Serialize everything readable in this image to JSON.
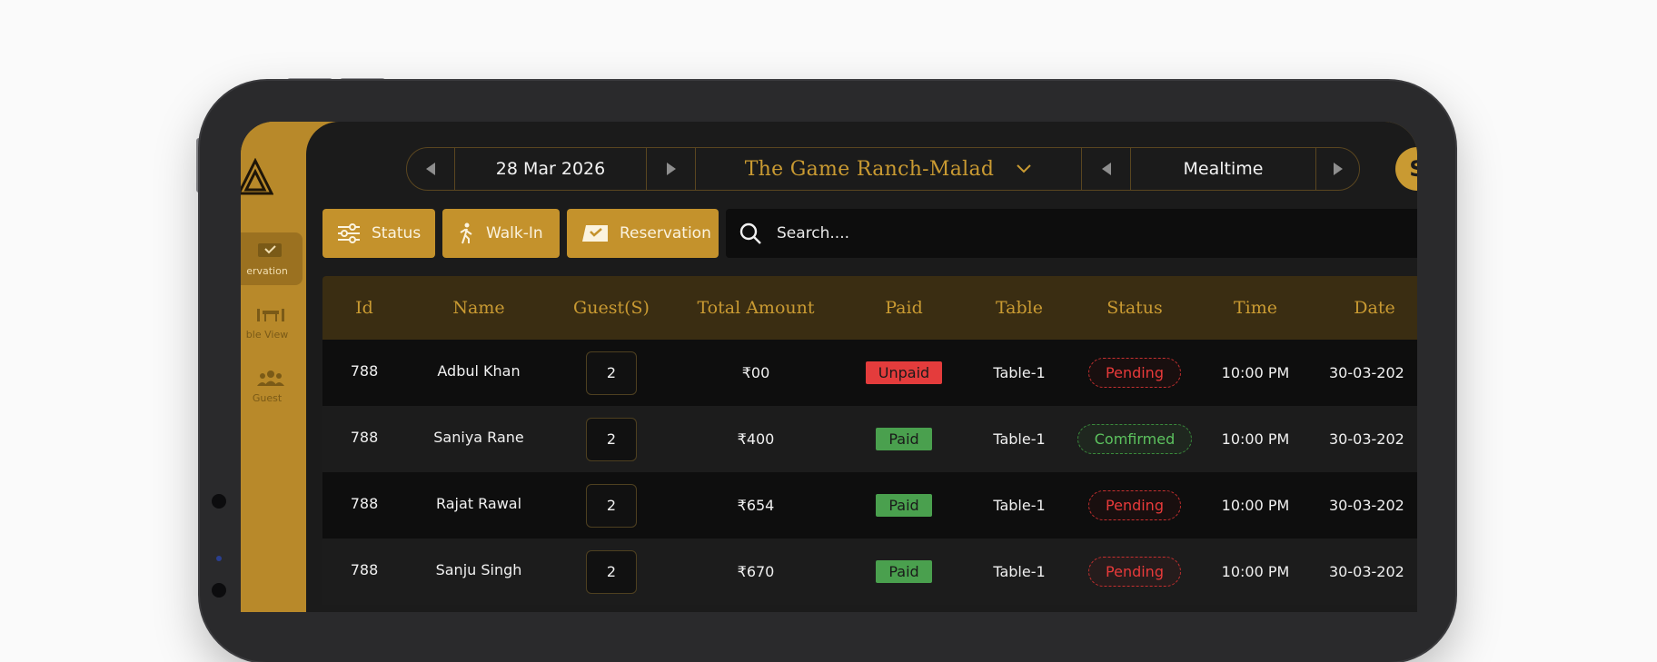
{
  "sidebar": {
    "items": [
      {
        "label": "ervation",
        "icon": "reservation-icon"
      },
      {
        "label": "ble View",
        "icon": "table-view-icon"
      },
      {
        "label": "Guest",
        "icon": "guest-icon"
      }
    ]
  },
  "topnav": {
    "date": "28 Mar 2026",
    "restaurant": "The Game Ranch-Malad",
    "mealtime": "Mealtime"
  },
  "avatar": {
    "initial": "S"
  },
  "actions": {
    "status_label": "Status",
    "walkin_label": "Walk-In",
    "reservation_label": "Reservation"
  },
  "search": {
    "placeholder": "Search...."
  },
  "table": {
    "columns": [
      "Id",
      "Name",
      "Guest(S)",
      "Total Amount",
      "Paid",
      "Table",
      "Status",
      "Time",
      "Date"
    ],
    "rows": [
      {
        "id": "788",
        "name": "Adbul Khan",
        "guests": "2",
        "amount": "₹00",
        "paid": "Unpaid",
        "table": "Table-1",
        "status": "Pending",
        "time": "10:00 PM",
        "date": "30-03-202"
      },
      {
        "id": "788",
        "name": "Saniya Rane",
        "guests": "2",
        "amount": "₹400",
        "paid": "Paid",
        "table": "Table-1",
        "status": "Comfirmed",
        "time": "10:00 PM",
        "date": "30-03-202"
      },
      {
        "id": "788",
        "name": "Rajat Rawal",
        "guests": "2",
        "amount": "₹654",
        "paid": "Paid",
        "table": "Table-1",
        "status": "Pending",
        "time": "10:00 PM",
        "date": "30-03-202"
      },
      {
        "id": "788",
        "name": "Sanju Singh",
        "guests": "2",
        "amount": "₹670",
        "paid": "Paid",
        "table": "Table-1",
        "status": "Pending",
        "time": "10:00 PM",
        "date": "30-03-202"
      }
    ]
  },
  "colors": {
    "accent": "#c4922c",
    "unpaid": "#e43c3c",
    "paid": "#4aa04e",
    "pending": "#e83a3a",
    "confirmed": "#5cc25e"
  }
}
